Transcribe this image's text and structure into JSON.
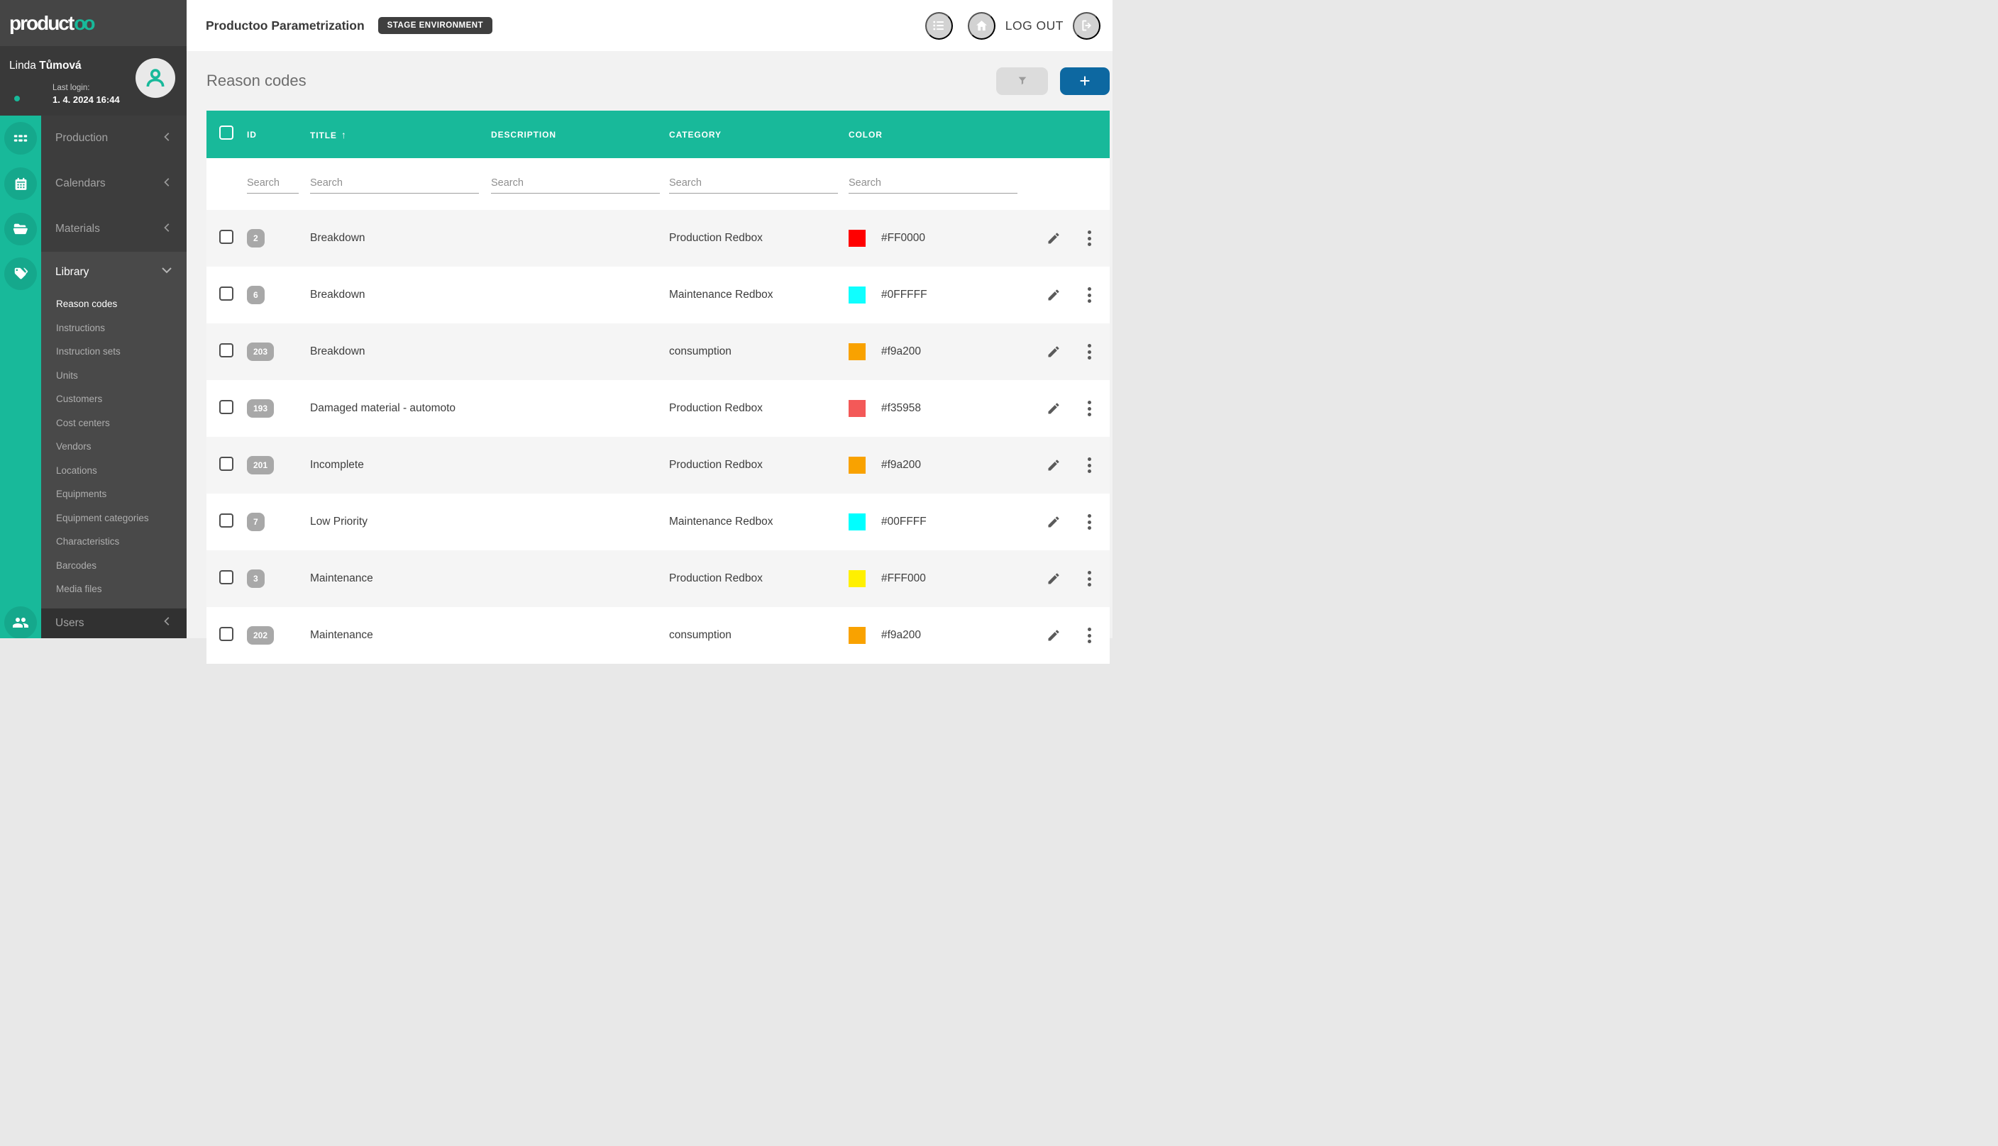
{
  "sidebar": {
    "logo": {
      "part1": "product",
      "part2": "oo"
    },
    "user": {
      "first": "Linda ",
      "last": "Tůmová",
      "last_login_label": "Last login:",
      "last_login_value": "1. 4. 2024 16:44"
    },
    "nav": [
      {
        "label": "Production"
      },
      {
        "label": "Calendars"
      },
      {
        "label": "Materials"
      }
    ],
    "library": {
      "label": "Library",
      "items": [
        "Reason codes",
        "Instructions",
        "Instruction sets",
        "Units",
        "Customers",
        "Cost centers",
        "Vendors",
        "Locations",
        "Equipments",
        "Equipment categories",
        "Characteristics",
        "Barcodes",
        "Media files"
      ],
      "active_item": "Reason codes"
    },
    "users_label": "Users"
  },
  "topbar": {
    "title": "Productoo Parametrization",
    "environment_badge": "STAGE ENVIRONMENT",
    "logout_label": "LOG OUT"
  },
  "page": {
    "title": "Reason codes"
  },
  "table": {
    "columns": [
      "ID",
      "TITLE",
      "DESCRIPTION",
      "CATEGORY",
      "COLOR"
    ],
    "sorted_column": "TITLE",
    "sort_indicator": "↑",
    "search_placeholder": "Search",
    "rows": [
      {
        "id": "2",
        "title": "Breakdown",
        "description": "",
        "category": "Production Redbox",
        "color": "#FF0000"
      },
      {
        "id": "6",
        "title": "Breakdown",
        "description": "",
        "category": "Maintenance Redbox",
        "color": "#0FFFFF"
      },
      {
        "id": "203",
        "title": "Breakdown",
        "description": "",
        "category": "consumption",
        "color": "#f9a200"
      },
      {
        "id": "193",
        "title": "Damaged material - automoto",
        "description": "",
        "category": "Production Redbox",
        "color": "#f35958"
      },
      {
        "id": "201",
        "title": "Incomplete",
        "description": "",
        "category": "Production Redbox",
        "color": "#f9a200"
      },
      {
        "id": "7",
        "title": "Low Priority",
        "description": "",
        "category": "Maintenance Redbox",
        "color": "#00FFFF"
      },
      {
        "id": "3",
        "title": "Maintenance",
        "description": "",
        "category": "Production Redbox",
        "color": "#FFF000"
      },
      {
        "id": "202",
        "title": "Maintenance",
        "description": "",
        "category": "consumption",
        "color": "#f9a200"
      }
    ]
  },
  "colors": {
    "accent_teal": "#18b99a",
    "add_button_blue": "#0d68a1",
    "stage_badge_bg": "#3f3f3f"
  }
}
